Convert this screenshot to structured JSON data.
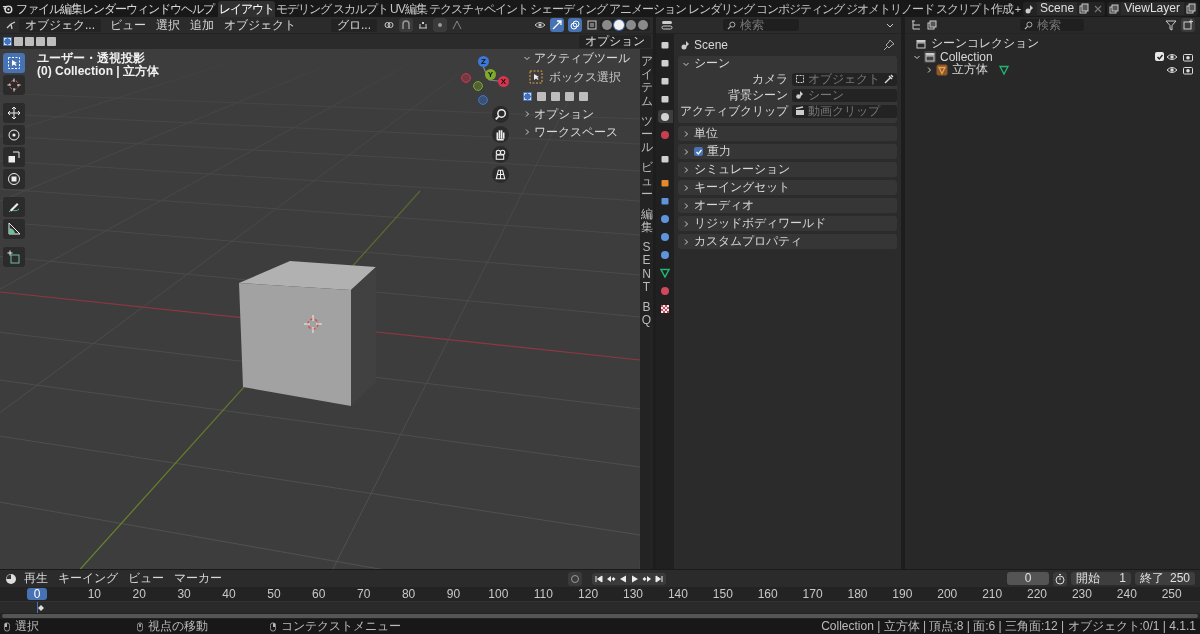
{
  "top_bar": {
    "menus": [
      "ファイル",
      "編集",
      "レンダー",
      "ウィンドウ",
      "ヘルプ"
    ],
    "workspaces": [
      {
        "label": "レイアウト",
        "selected": true
      },
      {
        "label": "モデリング",
        "selected": false
      },
      {
        "label": "スカルプト",
        "selected": false
      },
      {
        "label": "UV編集",
        "selected": false
      },
      {
        "label": "テクスチャペイント",
        "selected": false
      },
      {
        "label": "シェーディング",
        "selected": false
      },
      {
        "label": "アニメーション",
        "selected": false
      },
      {
        "label": "レンダリング",
        "selected": false
      },
      {
        "label": "コンポジティング",
        "selected": false
      },
      {
        "label": "ジオメトリノード",
        "selected": false
      },
      {
        "label": "スクリプト作成",
        "selected": false
      }
    ],
    "add_workspace": "+",
    "scene": "Scene",
    "view_layer": "ViewLayer"
  },
  "viewport": {
    "mode": "オブジェク...",
    "menus": [
      "ビュー",
      "選択",
      "追加",
      "オブジェクト"
    ],
    "orientation": "グロ...",
    "options": "オプション",
    "select_modes": [
      {
        "selected": true
      },
      {
        "selected": false
      },
      {
        "selected": false
      },
      {
        "selected": false
      },
      {
        "selected": false
      }
    ],
    "shading": [
      {
        "selected": false
      },
      {
        "selected": true
      },
      {
        "selected": false
      },
      {
        "selected": false
      }
    ],
    "view_name": "ユーザー・透視投影",
    "context": "(0) Collection | 立方体",
    "tools": [
      {
        "kind": "select",
        "selected": true
      },
      {
        "kind": "cursor",
        "selected": false
      },
      {
        "kind": "move",
        "selected": false
      },
      {
        "kind": "rotate",
        "selected": false
      },
      {
        "kind": "scale",
        "selected": false
      },
      {
        "kind": "transform",
        "selected": false
      },
      {
        "kind": "annotate",
        "selected": false
      },
      {
        "kind": "measure",
        "selected": false
      },
      {
        "kind": "add",
        "selected": false
      }
    ],
    "gizmo": [
      "Z",
      "Y",
      "X"
    ],
    "sidebar": {
      "title": "アクティブツール",
      "expanded": true,
      "tool": "ボックス選択",
      "select_modes": [
        {
          "selected": true
        },
        {
          "selected": false
        },
        {
          "selected": false
        },
        {
          "selected": false
        },
        {
          "selected": false
        }
      ],
      "sections": [
        "オプション",
        "ワークスペース"
      ]
    },
    "side_tabs": [
      "アイテム",
      "ツール",
      "ビュー",
      "編集",
      "SENT",
      "BQ"
    ]
  },
  "properties": {
    "search_placeholder": "検索",
    "context": "Scene",
    "tabs": [
      {
        "kind": "tool",
        "selected": false
      },
      {
        "kind": "render",
        "selected": false
      },
      {
        "kind": "output",
        "selected": false
      },
      {
        "kind": "view_layer",
        "selected": false
      },
      {
        "kind": "scene",
        "selected": true
      },
      {
        "kind": "world",
        "selected": false
      },
      {
        "kind": "collection",
        "selected": false
      },
      {
        "kind": "object",
        "selected": false
      },
      {
        "kind": "modifier",
        "selected": false
      },
      {
        "kind": "particles",
        "selected": false
      },
      {
        "kind": "physics",
        "selected": false
      },
      {
        "kind": "constraints",
        "selected": false
      },
      {
        "kind": "data",
        "selected": false
      },
      {
        "kind": "material",
        "selected": false
      },
      {
        "kind": "texture",
        "selected": false
      }
    ],
    "panel": {
      "title": "シーン",
      "expanded": true,
      "fields": [
        {
          "label": "カメラ",
          "placeholder": "オブジェクト",
          "kind": "object"
        },
        {
          "label": "背景シーン",
          "placeholder": "シーン",
          "kind": "scene"
        },
        {
          "label": "アクティブクリップ",
          "placeholder": "動画クリップ",
          "kind": "clip"
        }
      ]
    },
    "sections": [
      {
        "label": "単位",
        "kind": "plain",
        "expanded": false
      },
      {
        "label": "重力",
        "kind": "checkbox",
        "checked": true,
        "expanded": false
      },
      {
        "label": "シミュレーション",
        "kind": "plain",
        "expanded": false
      },
      {
        "label": "キーイングセット",
        "kind": "plain",
        "expanded": false
      },
      {
        "label": "オーディオ",
        "kind": "plain",
        "expanded": false
      },
      {
        "label": "リジッドボディワールド",
        "kind": "plain",
        "expanded": false
      },
      {
        "label": "カスタムプロパティ",
        "kind": "plain",
        "expanded": false
      }
    ]
  },
  "outliner": {
    "search_placeholder": "検索",
    "root": "シーンコレクション",
    "collections": [
      {
        "label": "Collection",
        "expanded": true,
        "checked": true,
        "children": [
          {
            "label": "立方体",
            "expanded": false
          }
        ]
      }
    ]
  },
  "timeline": {
    "menus": [
      "再生",
      "キーイング",
      "ビュー",
      "マーカー"
    ],
    "current_frame": "0",
    "start_label": "開始",
    "start": "1",
    "end_label": "終了",
    "end": "250",
    "playhead": "0",
    "ruler": [
      "10",
      "20",
      "30",
      "40",
      "50",
      "60",
      "70",
      "80",
      "90",
      "100",
      "110",
      "120",
      "130",
      "140",
      "150",
      "160",
      "170",
      "180",
      "190",
      "200",
      "210",
      "220",
      "230",
      "240",
      "250"
    ]
  },
  "status_bar": {
    "hints": [
      "選択",
      "視点の移動",
      "コンテクストメニュー"
    ],
    "info": "Collection | 立方体 | 頂点:8 | 面:6 | 三角面:12 | オブジェクト:0/1 | 4.1.1"
  }
}
